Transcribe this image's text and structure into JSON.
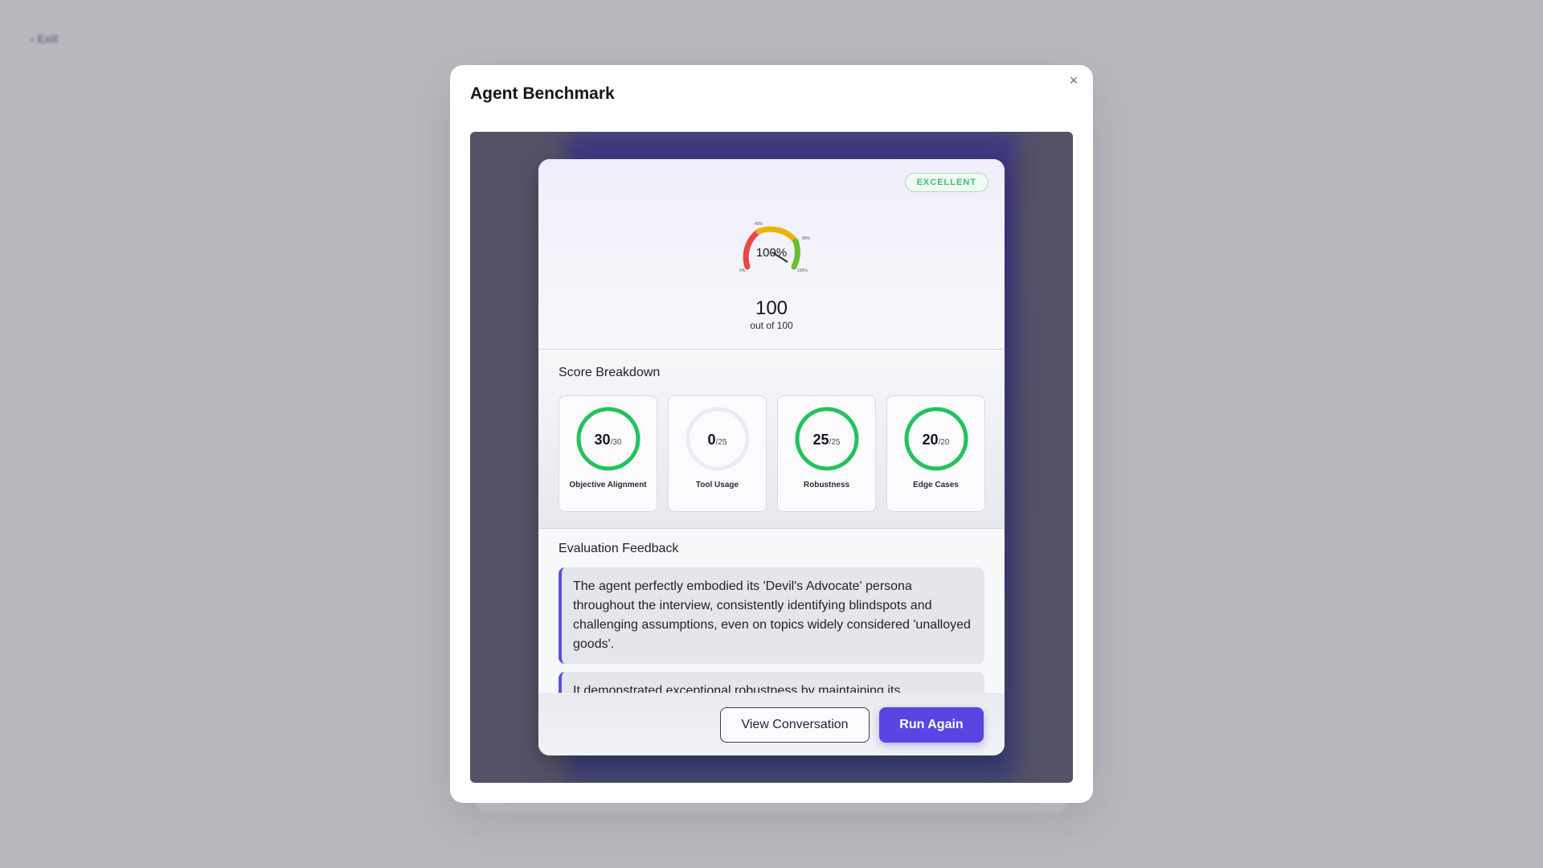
{
  "background": {
    "exit_label": "‹  Exit"
  },
  "modal": {
    "title": "Agent Benchmark",
    "close_icon": "×"
  },
  "result": {
    "badge": "EXCELLENT",
    "gauge": {
      "value_label": "100%",
      "percent": 100,
      "tick_labels": [
        "0%",
        "40%",
        "80%",
        "100%"
      ]
    },
    "score": "100",
    "score_sub": "out of 100"
  },
  "breakdown": {
    "title": "Score Breakdown",
    "metrics": [
      {
        "score": "30",
        "max": "/30",
        "label": "Objective Alignment",
        "fraction": 1.0
      },
      {
        "score": "0",
        "max": "/25",
        "label": "Tool Usage",
        "fraction": 0.0
      },
      {
        "score": "25",
        "max": "/25",
        "label": "Robustness",
        "fraction": 1.0
      },
      {
        "score": "20",
        "max": "/20",
        "label": "Edge Cases",
        "fraction": 1.0
      }
    ]
  },
  "feedback": {
    "title": "Evaluation Feedback",
    "items": [
      "The agent perfectly embodied its 'Devil's Advocate' persona throughout the interview, consistently identifying blindspots and challenging assumptions, even on topics widely considered 'unalloyed goods'.",
      "It demonstrated exceptional robustness by maintaining its"
    ]
  },
  "footer": {
    "view_conversation": "View Conversation",
    "run_again": "Run Again"
  },
  "colors": {
    "accent": "#5a45e3",
    "success": "#22c35a",
    "badge_text": "#3fbf6a",
    "gauge_red": "#ef4444",
    "gauge_yellow": "#eab308",
    "gauge_green": "#65c030"
  }
}
